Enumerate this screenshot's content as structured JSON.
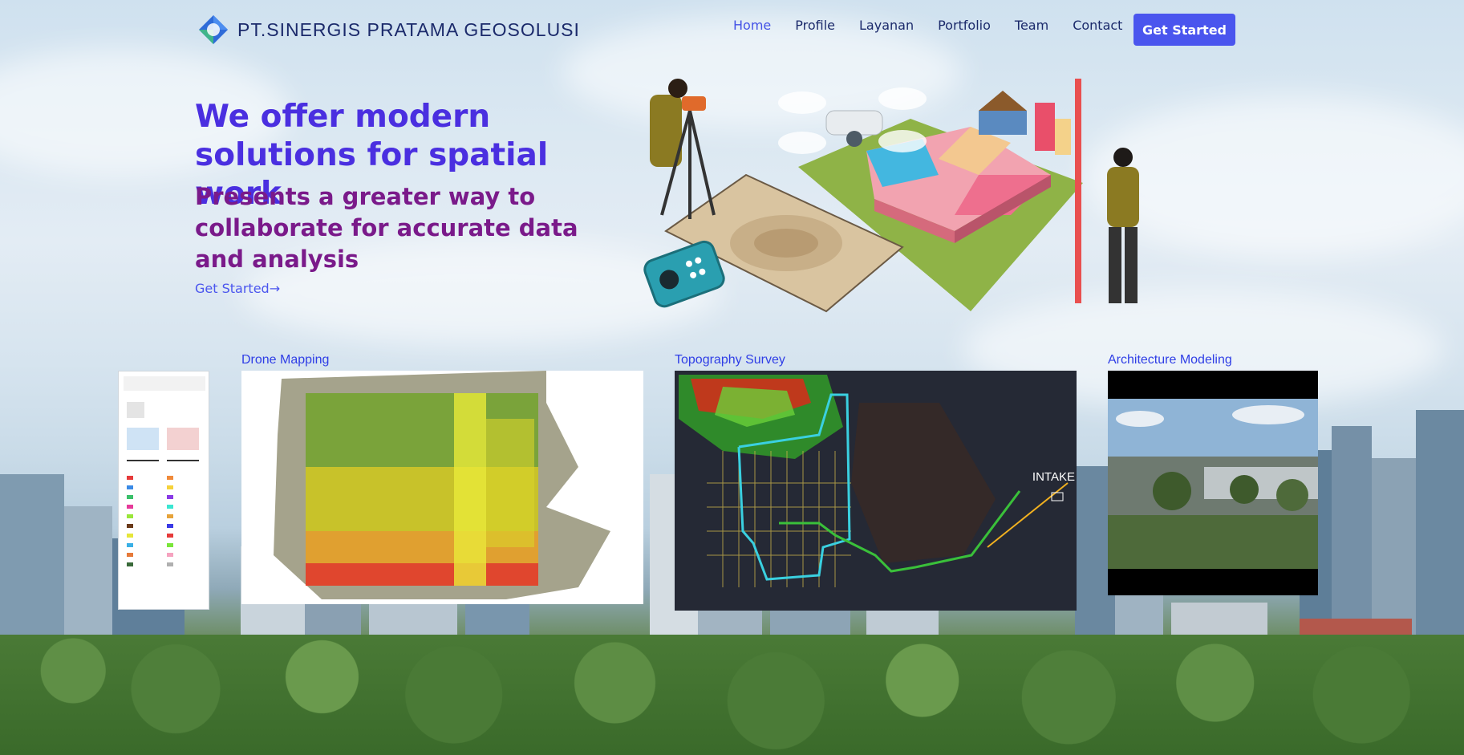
{
  "header": {
    "brand": "PT.SINERGIS PRATAMA GEOSOLUSI",
    "nav": [
      {
        "label": "Home",
        "active": true
      },
      {
        "label": "Profile",
        "active": false
      },
      {
        "label": "Layanan",
        "active": false
      },
      {
        "label": "Portfolio",
        "active": false
      },
      {
        "label": "Team",
        "active": false
      },
      {
        "label": "Contact",
        "active": false
      }
    ],
    "cta_label": "Get Started"
  },
  "hero": {
    "title": "We offer modern solutions for spatial work",
    "subtitle": "Presents a greater way to collaborate for accurate data and analysis",
    "link_label": "Get Started",
    "link_arrow": "→"
  },
  "cards": [
    {
      "label": "Drone Mapping"
    },
    {
      "label": "Topography Survey",
      "overlay_text": "INTAKE"
    },
    {
      "label": "Architecture Modeling"
    }
  ],
  "colors": {
    "accent": "#4a55ee",
    "title": "#4a2fe0",
    "subtitle": "#7a1a8a",
    "nav": "#1b2a6b"
  }
}
